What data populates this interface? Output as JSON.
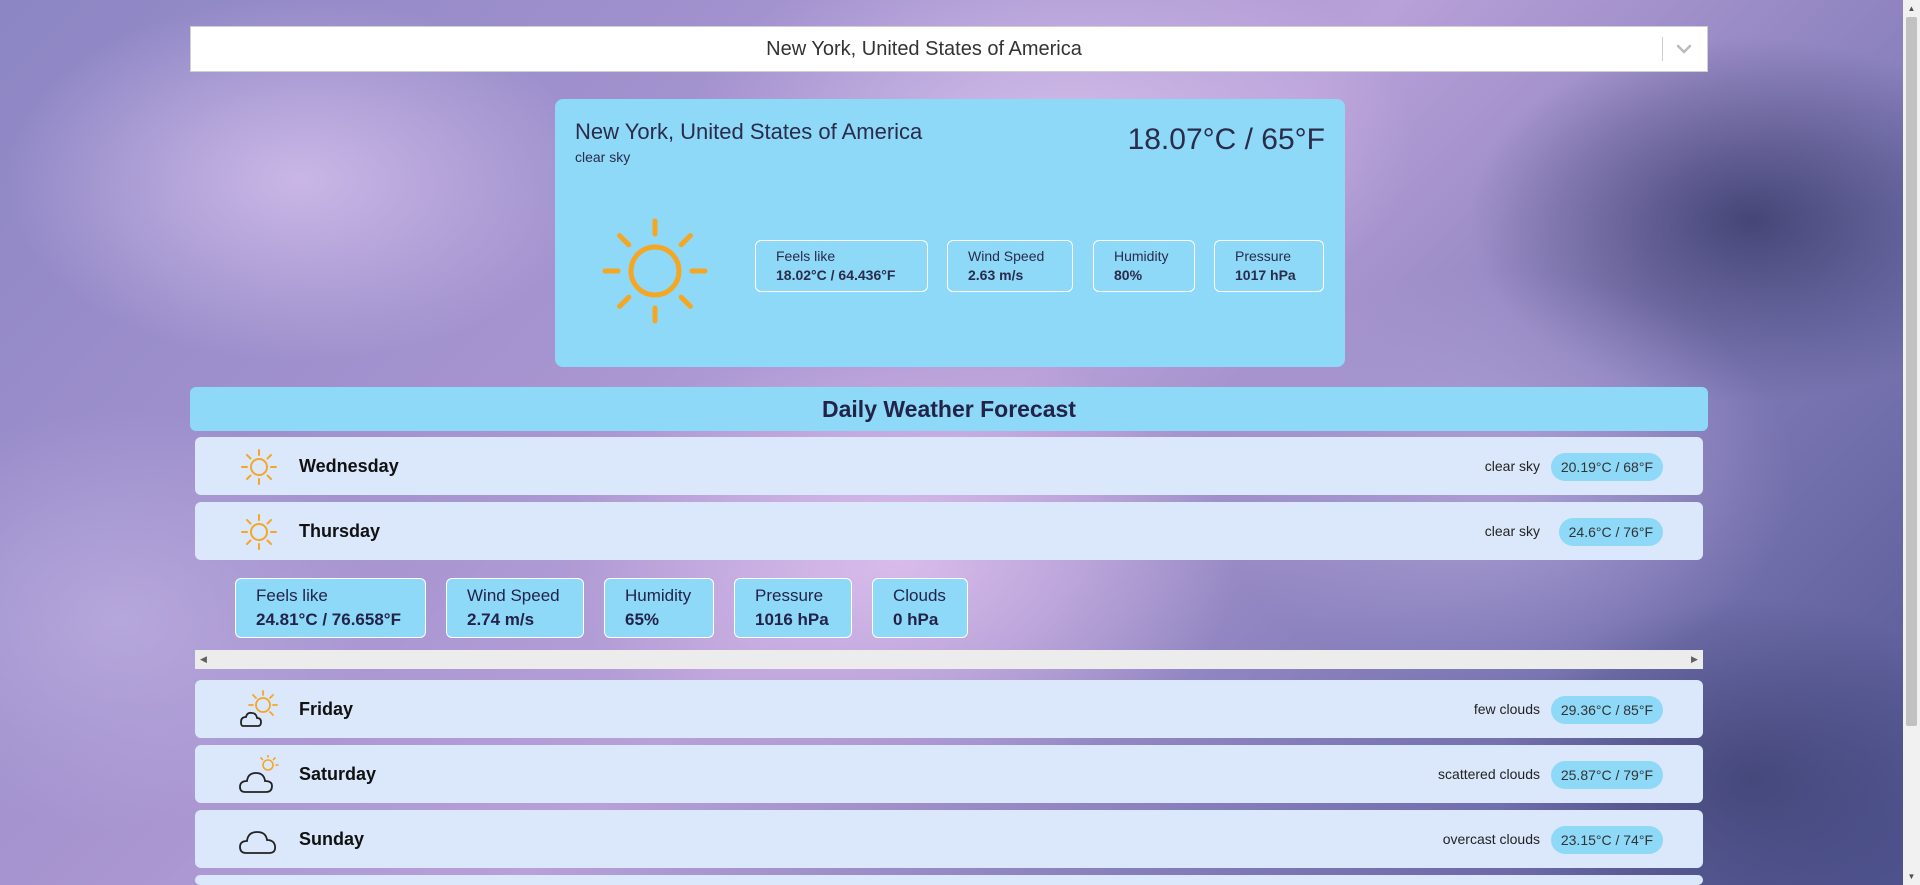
{
  "search": {
    "value": "New York, United States of America"
  },
  "current": {
    "city": "New York, United States of America",
    "description": "clear sky",
    "temperature": "18.07°C / 65°F",
    "icon": "sun-icon",
    "stats": [
      {
        "label": "Feels like",
        "value": "18.02°C / 64.436°F"
      },
      {
        "label": "Wind Speed",
        "value": "2.63 m/s"
      },
      {
        "label": "Humidity",
        "value": "80%"
      },
      {
        "label": "Pressure",
        "value": "1017 hPa"
      }
    ]
  },
  "forecast": {
    "title": "Daily Weather Forecast",
    "days": [
      {
        "day": "Wednesday",
        "condition": "clear sky",
        "temp": "20.19°C / 68°F",
        "icon": "sun-icon"
      },
      {
        "day": "Thursday",
        "condition": "clear sky",
        "temp": "24.6°C / 76°F",
        "icon": "sun-icon"
      },
      {
        "day": "Friday",
        "condition": "few clouds",
        "temp": "29.36°C / 85°F",
        "icon": "sun-cloud-icon"
      },
      {
        "day": "Saturday",
        "condition": "scattered clouds",
        "temp": "25.87°C / 79°F",
        "icon": "cloud-sun-icon"
      },
      {
        "day": "Sunday",
        "condition": "overcast clouds",
        "temp": "23.15°C / 74°F",
        "icon": "cloud-icon"
      }
    ],
    "thursday_details": [
      {
        "label": "Feels like",
        "value": "24.81°C / 76.658°F"
      },
      {
        "label": "Wind Speed",
        "value": "2.74 m/s"
      },
      {
        "label": "Humidity",
        "value": "65%"
      },
      {
        "label": "Pressure",
        "value": "1016 hPa"
      },
      {
        "label": "Clouds",
        "value": "0 hPa"
      }
    ]
  },
  "colors": {
    "card": "#8ed9f8",
    "row": "#dbe8fb",
    "sun": "#f5a623"
  }
}
